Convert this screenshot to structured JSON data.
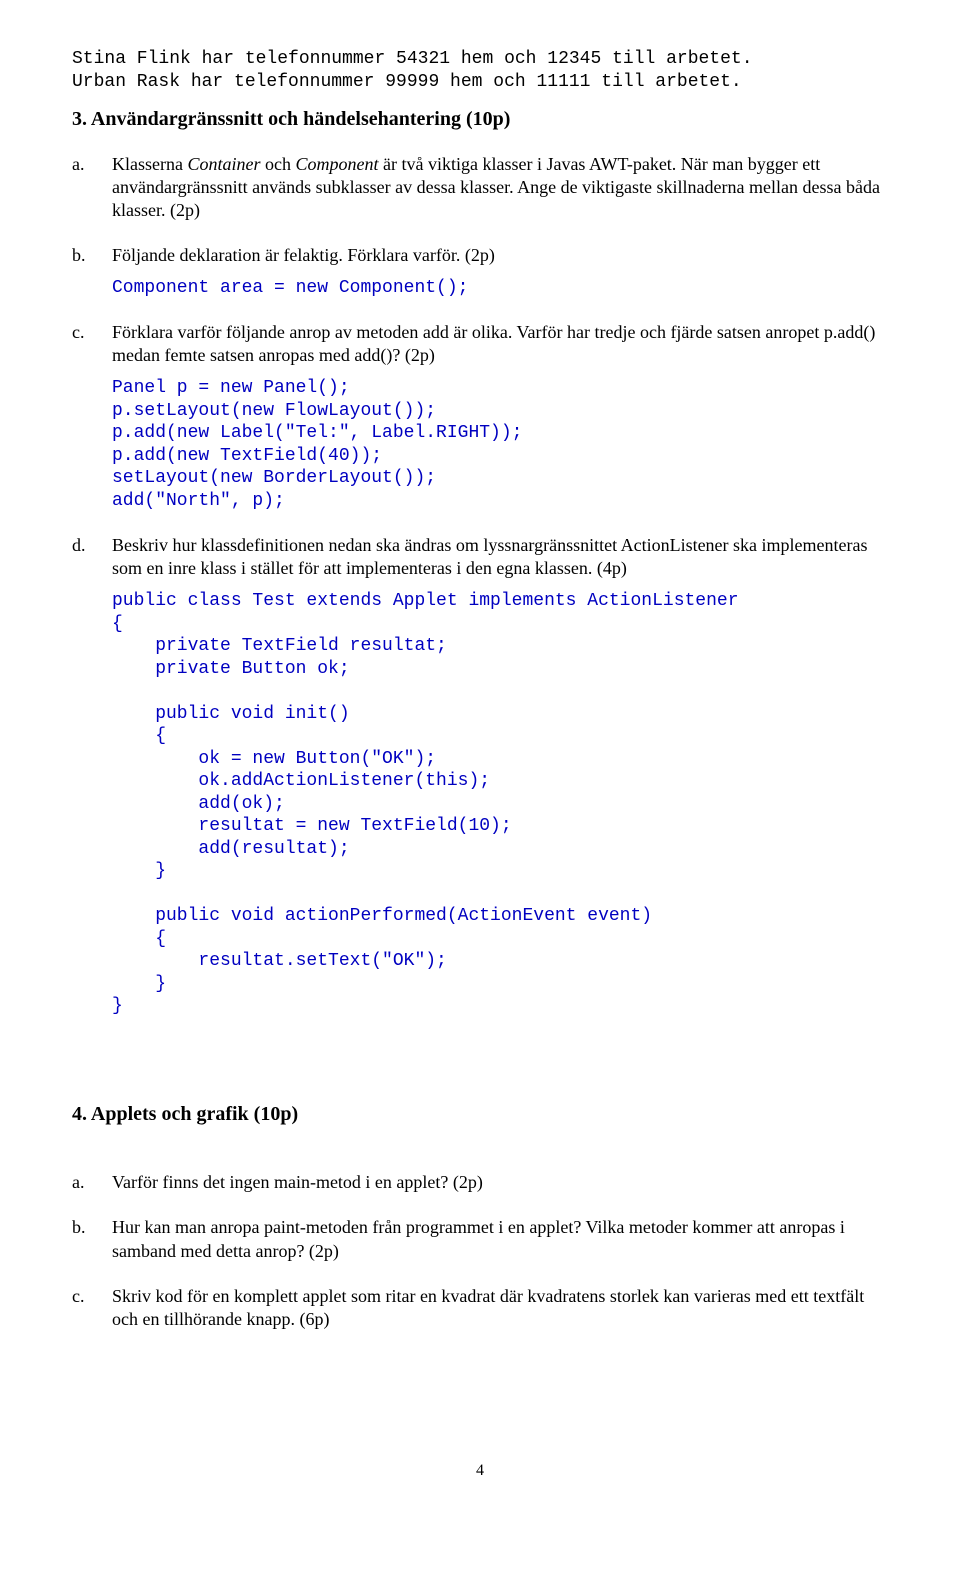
{
  "intro_mono_line1": "Stina Flink har telefonnummer 54321 hem och 12345 till arbetet.",
  "intro_mono_line2": "Urban Rask har telefonnummer 99999 hem och 11111 till arbetet.",
  "section3_heading": "3. Användargränssnitt och händelsehantering (10p)",
  "q3": {
    "a": {
      "label": "a.",
      "text_pre": "Klasserna ",
      "italic1": "Container",
      "mid1": " och ",
      "italic2": "Component",
      "text_post": " är två viktiga klasser i Javas AWT-paket. När man bygger ett användargränssnitt används subklasser av dessa klasser. Ange de viktigaste skillnaderna mellan dessa båda klasser. (2p)"
    },
    "b": {
      "label": "b.",
      "text": "Följande deklaration är felaktig. Förklara varför. (2p)",
      "code": "Component area = new Component();"
    },
    "c": {
      "label": "c.",
      "text": "Förklara varför följande anrop av metoden add är olika. Varför har tredje och fjärde satsen anropet p.add() medan femte satsen anropas med add()? (2p)",
      "code": "Panel p = new Panel();\np.setLayout(new FlowLayout());\np.add(new Label(\"Tel:\", Label.RIGHT));\np.add(new TextField(40));\nsetLayout(new BorderLayout());\nadd(\"North\", p);"
    },
    "d": {
      "label": "d.",
      "text": "Beskriv hur klassdefinitionen nedan ska ändras om lyssnargränssnittet ActionListener ska implementeras som en inre klass i stället för att implementeras i den egna klassen. (4p)",
      "code": "public class Test extends Applet implements ActionListener\n{\n    private TextField resultat;\n    private Button ok;\n\n    public void init()\n    {\n        ok = new Button(\"OK\");\n        ok.addActionListener(this);\n        add(ok);\n        resultat = new TextField(10);\n        add(resultat);\n    }\n\n    public void actionPerformed(ActionEvent event)\n    {\n        resultat.setText(\"OK\");\n    }\n}"
    }
  },
  "section4_heading": "4. Applets och grafik (10p)",
  "q4": {
    "a": {
      "label": "a.",
      "text": "Varför finns det ingen main-metod i en applet? (2p)"
    },
    "b": {
      "label": "b.",
      "text": "Hur kan man anropa paint-metoden från programmet i en applet? Vilka metoder kommer att anropas i samband med detta anrop? (2p)"
    },
    "c": {
      "label": "c.",
      "text": "Skriv kod för en komplett applet som ritar en kvadrat där kvadratens storlek kan varieras med ett textfält och en tillhörande knapp. (6p)"
    }
  },
  "page_number": "4"
}
